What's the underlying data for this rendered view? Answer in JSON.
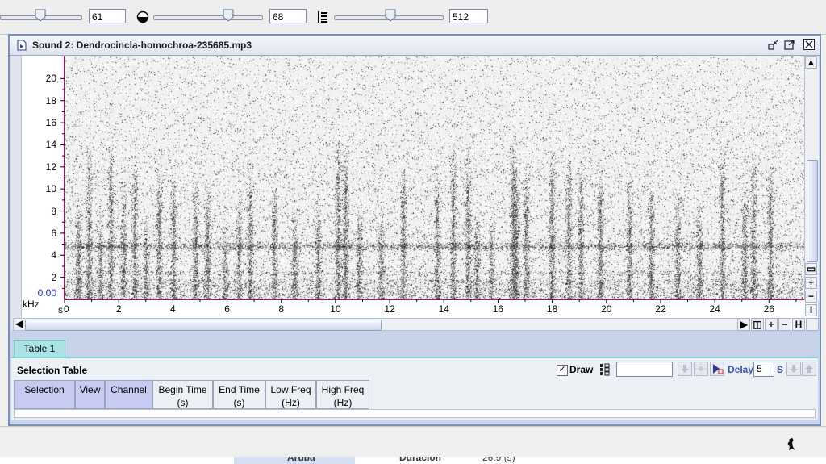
{
  "toolbar": {
    "slider1_value": "61",
    "slider2_value": "68",
    "slider3_value": "512",
    "slider1_level": 0.38,
    "slider2_level": 0.68,
    "slider3_level": 0.5
  },
  "window": {
    "title": "Sound 2: Dendrocincla-homochroa-235685.mp3"
  },
  "spectrogram": {
    "y_unit": "kHz",
    "x_unit": "s",
    "y_ticks": [
      "20",
      "18",
      "16",
      "14",
      "12",
      "10",
      "8",
      "6",
      "4",
      "2"
    ],
    "y_zero": "0.00",
    "x_ticks": [
      "0",
      "2",
      "4",
      "6",
      "8",
      "10",
      "12",
      "14",
      "16",
      "18",
      "20",
      "22",
      "24",
      "26"
    ],
    "y_max_khz": 22,
    "x_max_s": 27.3,
    "colors": {
      "axis": "#c0006a",
      "zero_label": "#1f33c6"
    }
  },
  "table": {
    "tab_label": "Table 1",
    "title": "Selection Table",
    "draw_label": "Draw",
    "draw_checked": true,
    "delay_label": "Delay:",
    "delay_value": "5",
    "delay_unit": "S",
    "columns": [
      {
        "label": "Selection",
        "sub": ""
      },
      {
        "label": "View",
        "sub": ""
      },
      {
        "label": "Channel",
        "sub": ""
      },
      {
        "label": "Begin Time",
        "sub": "(s)"
      },
      {
        "label": "End Time",
        "sub": "(s)"
      },
      {
        "label": "Low Freq",
        "sub": "(Hz)"
      },
      {
        "label": "High Freq",
        "sub": "(Hz)"
      }
    ]
  },
  "background": {
    "left_text": "Aruba",
    "mid_label": "Duración",
    "mid_value": "26.9 (s)"
  }
}
